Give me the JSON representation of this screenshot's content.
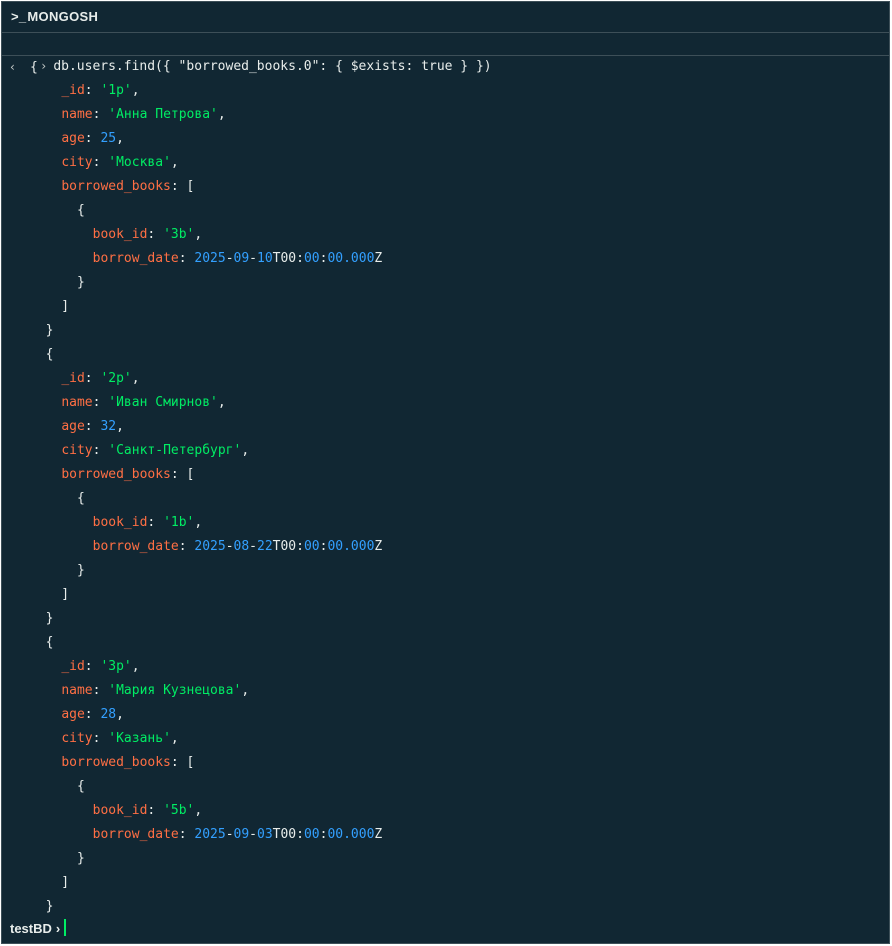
{
  "window": {
    "title": "MONGOSH",
    "title_prefix": ">_"
  },
  "command": {
    "prompt_symbol": "›",
    "text": "db.users.find({ \"borrowed_books.0\": { $exists: true } })"
  },
  "result_marker": "‹",
  "results": [
    {
      "_id": "'1p'",
      "name": "'Анна Петрова'",
      "age": "25",
      "city": "'Москва'",
      "book_id": "'3b'",
      "borrow_date": {
        "y": "2025",
        "m": "09",
        "d": "10",
        "h": "00",
        "mi": "00",
        "s": "00.000"
      }
    },
    {
      "_id": "'2p'",
      "name": "'Иван Смирнов'",
      "age": "32",
      "city": "'Санкт-Петербург'",
      "book_id": "'1b'",
      "borrow_date": {
        "y": "2025",
        "m": "08",
        "d": "22",
        "h": "00",
        "mi": "00",
        "s": "00.000"
      }
    },
    {
      "_id": "'3p'",
      "name": "'Мария Кузнецова'",
      "age": "28",
      "city": "'Казань'",
      "book_id": "'5b'",
      "borrow_date": {
        "y": "2025",
        "m": "09",
        "d": "03",
        "h": "00",
        "mi": "00",
        "s": "00.000"
      }
    }
  ],
  "keys": {
    "id": "_id",
    "name": "name",
    "age": "age",
    "city": "city",
    "borrowed_books": "borrowed_books",
    "book_id": "book_id",
    "borrow_date": "borrow_date"
  },
  "prompt": {
    "db_name": "testBD",
    "symbol": "›"
  },
  "colors": {
    "background": "#112733",
    "key": "#ff6f44",
    "string": "#00ed64",
    "number": "#33a0ff",
    "text": "#e8edeb",
    "cursor": "#00ed64"
  }
}
